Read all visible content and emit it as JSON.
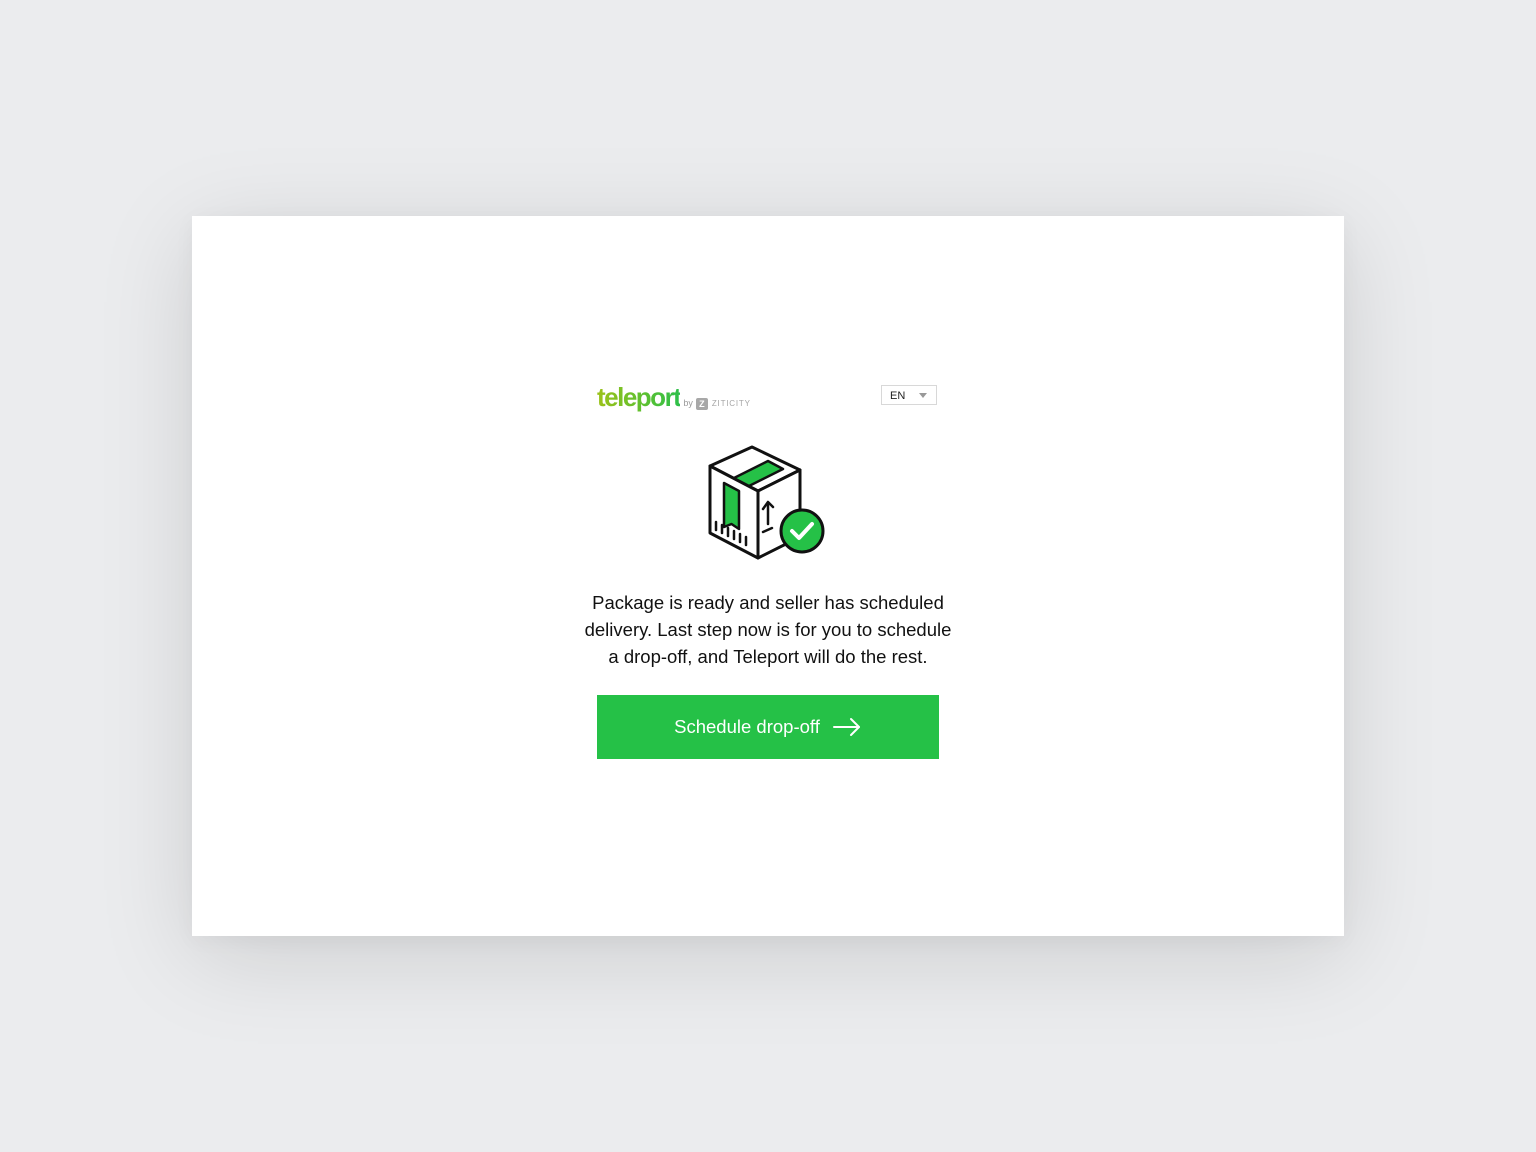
{
  "brand": {
    "name": "teleport",
    "by": "by",
    "partner_mark": "Z",
    "partner_name": "ZITICITY"
  },
  "language_select": {
    "selected": "EN",
    "icon": "chevron-down-icon"
  },
  "illustration": {
    "icon": "package-ready-icon",
    "badge_icon": "check-circle-icon"
  },
  "message": {
    "lines": [
      "Package is ready and seller has scheduled",
      "delivery. Last step now is for you to schedule",
      "a drop-off, and Teleport will do the rest."
    ]
  },
  "cta": {
    "label": "Schedule drop-off",
    "icon": "arrow-right-icon"
  },
  "colors": {
    "background": "#ebecee",
    "card": "#ffffff",
    "accent": "#25c147",
    "brand_gradient_start": "#9cc21a",
    "brand_gradient_end": "#2dbf4a",
    "text": "#111111"
  }
}
